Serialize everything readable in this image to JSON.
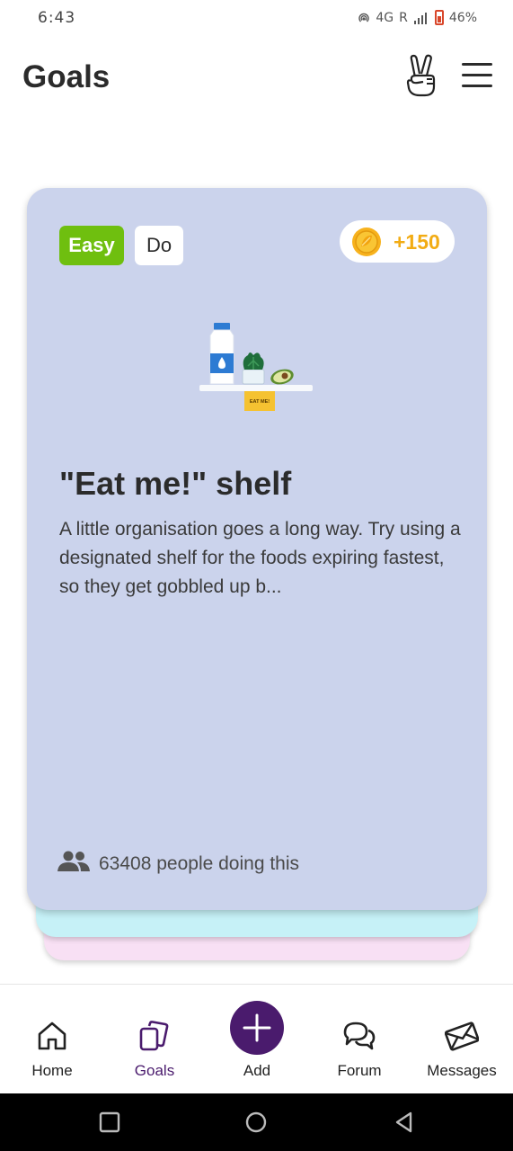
{
  "status_bar": {
    "time": "6:43",
    "network": "4G",
    "roaming": "R",
    "battery": "46%"
  },
  "header": {
    "title": "Goals",
    "icons": [
      "peace-hand-icon",
      "menu-icon"
    ]
  },
  "goal_card": {
    "difficulty": "Easy",
    "type": "Do",
    "reward": "+150",
    "title": "\"Eat me!\" shelf",
    "description": "A little organisation goes a long way. Try using a designated shelf for the foods expiring fastest, so they get gobbled up b...",
    "illustration_label": "EAT ME!",
    "people_count": "63408 people doing this",
    "colors": {
      "card": "#cbd3ec",
      "stack_second": "#c6f1f7",
      "stack_third": "#f8e0f4",
      "easy_badge": "#6fbf0f",
      "reward_text": "#f2ac14"
    }
  },
  "bottom_nav": {
    "items": [
      {
        "label": "Home",
        "icon": "home-icon"
      },
      {
        "label": "Goals",
        "icon": "goals-icon",
        "active": true
      },
      {
        "label": "Add",
        "icon": "add-icon"
      },
      {
        "label": "Forum",
        "icon": "forum-icon"
      },
      {
        "label": "Messages",
        "icon": "messages-icon"
      }
    ],
    "active_color": "#4a1b6d"
  }
}
